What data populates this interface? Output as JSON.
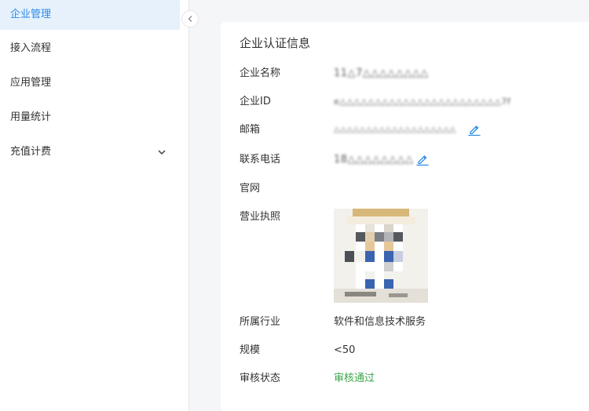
{
  "sidebar": {
    "items": [
      {
        "label": "企业管理",
        "active": true
      },
      {
        "label": "接入流程",
        "active": false
      },
      {
        "label": "应用管理",
        "active": false
      },
      {
        "label": "用量统计",
        "active": false
      },
      {
        "label": "充值计费",
        "active": false,
        "expandable": true
      }
    ],
    "collapse_icon": "chevron-left-icon",
    "expand_icon": "chevron-down-icon"
  },
  "card": {
    "title": "企业认证信息",
    "fields": {
      "company_name": {
        "label": "企业名称",
        "value": "11△7△△△△△△△△"
      },
      "company_id": {
        "label": "企业ID",
        "value": "e△△△△△△△△△△△△△△△△△△△△△△△7f"
      },
      "email": {
        "label": "邮箱",
        "value": "△△△△△△△△△△△△△△△△△△△"
      },
      "phone": {
        "label": "联系电话",
        "value": "18△△△△△△△△"
      },
      "website": {
        "label": "官网",
        "value": ""
      },
      "license": {
        "label": "营业执照"
      },
      "industry": {
        "label": "所属行业",
        "value": "软件和信息技术服务"
      },
      "scale": {
        "label": "规模",
        "value": "<50"
      },
      "review_status": {
        "label": "审核状态",
        "value": "审核通过"
      }
    }
  },
  "colors": {
    "accent": "#2c8ae8",
    "active_bg": "#e6f1fc",
    "status_pass": "#3aa548",
    "page_bg": "#f5f6f8"
  }
}
